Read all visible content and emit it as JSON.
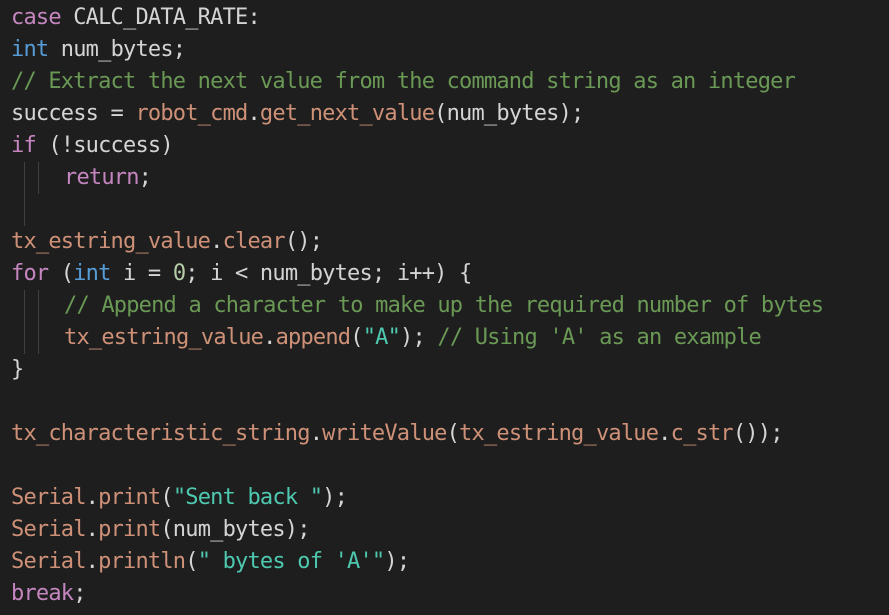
{
  "editor": {
    "lines": [
      {
        "indent": 0,
        "guides": 0,
        "tokens": [
          {
            "cls": "tok-keyword",
            "text": "case"
          },
          {
            "cls": "tok-plain",
            "text": " CALC_DATA_RATE:"
          }
        ]
      },
      {
        "indent": 0,
        "guides": 0,
        "tokens": [
          {
            "cls": "tok-type",
            "text": "int"
          },
          {
            "cls": "tok-plain",
            "text": " num_bytes;"
          }
        ]
      },
      {
        "indent": 0,
        "guides": 0,
        "tokens": [
          {
            "cls": "tok-comment",
            "text": "// Extract the next value from the command string as an integer"
          }
        ]
      },
      {
        "indent": 0,
        "guides": 0,
        "tokens": [
          {
            "cls": "tok-plain",
            "text": "success = "
          },
          {
            "cls": "tok-orange",
            "text": "robot_cmd"
          },
          {
            "cls": "tok-plain",
            "text": "."
          },
          {
            "cls": "tok-orange",
            "text": "get_next_value"
          },
          {
            "cls": "tok-plain",
            "text": "(num_bytes);"
          }
        ]
      },
      {
        "indent": 0,
        "guides": 0,
        "tokens": [
          {
            "cls": "tok-keyword",
            "text": "if"
          },
          {
            "cls": "tok-plain",
            "text": " (!success)"
          }
        ]
      },
      {
        "indent": 1,
        "guides": 2,
        "tokens": [
          {
            "cls": "tok-keyword",
            "text": "return"
          },
          {
            "cls": "tok-plain",
            "text": ";"
          }
        ]
      },
      {
        "indent": 0,
        "guides": 1,
        "tokens": []
      },
      {
        "indent": 0,
        "guides": 0,
        "tokens": [
          {
            "cls": "tok-orange",
            "text": "tx_estring_value"
          },
          {
            "cls": "tok-plain",
            "text": "."
          },
          {
            "cls": "tok-orange",
            "text": "clear"
          },
          {
            "cls": "tok-plain",
            "text": "();"
          }
        ]
      },
      {
        "indent": 0,
        "guides": 0,
        "tokens": [
          {
            "cls": "tok-keyword",
            "text": "for"
          },
          {
            "cls": "tok-plain",
            "text": " ("
          },
          {
            "cls": "tok-type",
            "text": "int"
          },
          {
            "cls": "tok-plain",
            "text": " i = "
          },
          {
            "cls": "tok-number",
            "text": "0"
          },
          {
            "cls": "tok-plain",
            "text": "; i < num_bytes; i++) {"
          }
        ]
      },
      {
        "indent": 1,
        "guides": 2,
        "tokens": [
          {
            "cls": "tok-comment",
            "text": "// Append a character to make up the required number of bytes"
          }
        ]
      },
      {
        "indent": 1,
        "guides": 2,
        "tokens": [
          {
            "cls": "tok-orange",
            "text": "tx_estring_value"
          },
          {
            "cls": "tok-plain",
            "text": "."
          },
          {
            "cls": "tok-orange",
            "text": "append"
          },
          {
            "cls": "tok-plain",
            "text": "("
          },
          {
            "cls": "tok-cyan",
            "text": "\"A\""
          },
          {
            "cls": "tok-plain",
            "text": "); "
          },
          {
            "cls": "tok-comment",
            "text": "// Using 'A' as an example"
          }
        ]
      },
      {
        "indent": 0,
        "guides": 0,
        "tokens": [
          {
            "cls": "tok-plain",
            "text": "}"
          }
        ]
      },
      {
        "indent": 0,
        "guides": 0,
        "tokens": []
      },
      {
        "indent": 0,
        "guides": 0,
        "tokens": [
          {
            "cls": "tok-orange",
            "text": "tx_characteristic_string"
          },
          {
            "cls": "tok-plain",
            "text": "."
          },
          {
            "cls": "tok-orange",
            "text": "writeValue"
          },
          {
            "cls": "tok-plain",
            "text": "("
          },
          {
            "cls": "tok-orange",
            "text": "tx_estring_value"
          },
          {
            "cls": "tok-plain",
            "text": "."
          },
          {
            "cls": "tok-orange",
            "text": "c_str"
          },
          {
            "cls": "tok-plain",
            "text": "());"
          }
        ]
      },
      {
        "indent": 0,
        "guides": 0,
        "tokens": []
      },
      {
        "indent": 0,
        "guides": 0,
        "tokens": [
          {
            "cls": "tok-orange",
            "text": "Serial"
          },
          {
            "cls": "tok-plain",
            "text": "."
          },
          {
            "cls": "tok-orange",
            "text": "print"
          },
          {
            "cls": "tok-plain",
            "text": "("
          },
          {
            "cls": "tok-cyan",
            "text": "\"Sent back \""
          },
          {
            "cls": "tok-plain",
            "text": ");"
          }
        ]
      },
      {
        "indent": 0,
        "guides": 0,
        "tokens": [
          {
            "cls": "tok-orange",
            "text": "Serial"
          },
          {
            "cls": "tok-plain",
            "text": "."
          },
          {
            "cls": "tok-orange",
            "text": "print"
          },
          {
            "cls": "tok-plain",
            "text": "(num_bytes);"
          }
        ]
      },
      {
        "indent": 0,
        "guides": 0,
        "tokens": [
          {
            "cls": "tok-orange",
            "text": "Serial"
          },
          {
            "cls": "tok-plain",
            "text": "."
          },
          {
            "cls": "tok-orange",
            "text": "println"
          },
          {
            "cls": "tok-plain",
            "text": "("
          },
          {
            "cls": "tok-cyan",
            "text": "\" bytes of 'A'\""
          },
          {
            "cls": "tok-plain",
            "text": ");"
          }
        ]
      },
      {
        "indent": 0,
        "guides": 0,
        "tokens": [
          {
            "cls": "tok-keyword",
            "text": "break"
          },
          {
            "cls": "tok-plain",
            "text": ";"
          }
        ]
      }
    ]
  },
  "colors": {
    "background": "#1e1e1e",
    "keyword": "#c586c0",
    "type": "#569cd6",
    "comment": "#6a9955",
    "function": "#ce9178",
    "string": "#4ec9b0",
    "number": "#b5cea8",
    "text": "#d4d4d4"
  }
}
